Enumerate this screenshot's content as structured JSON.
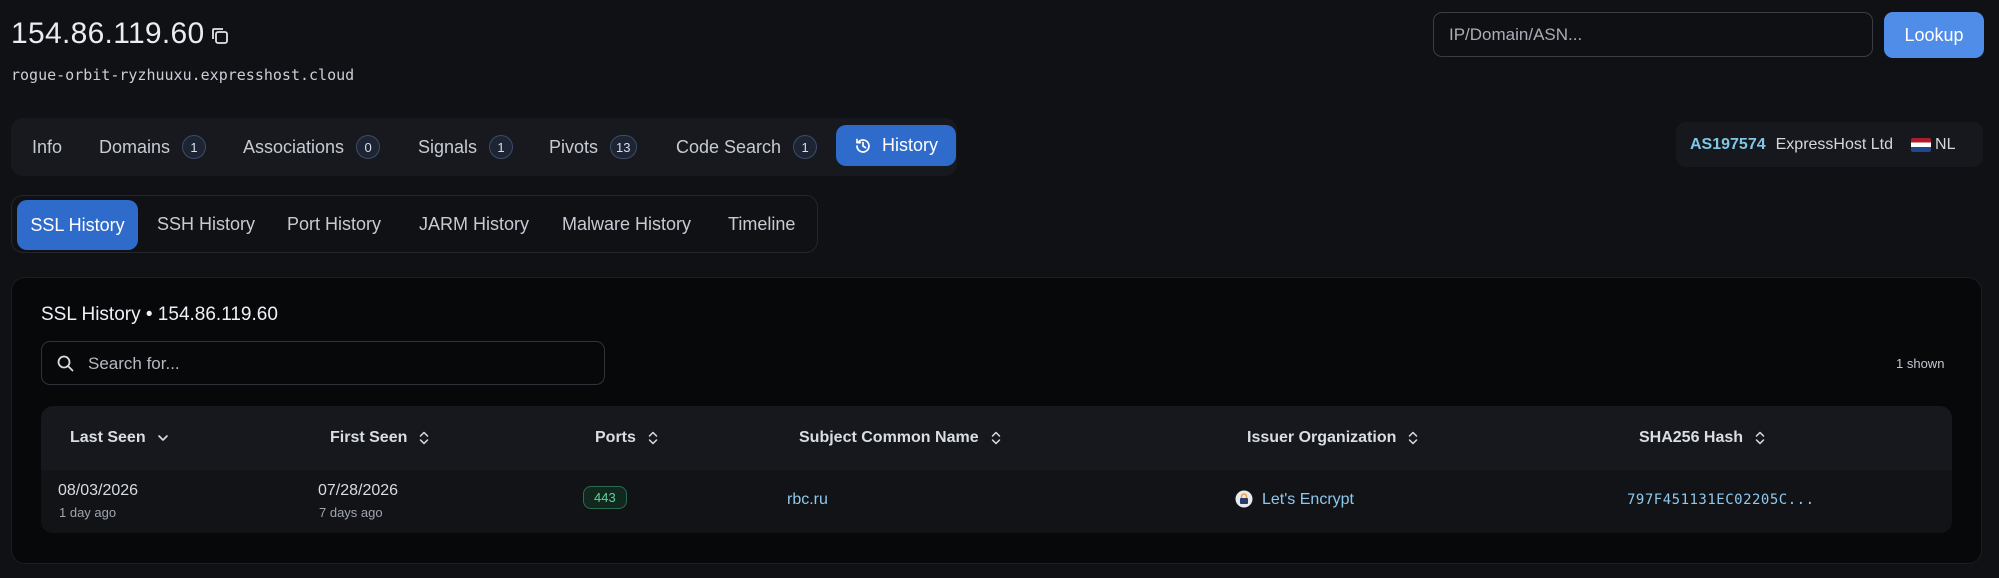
{
  "header": {
    "ip": "154.86.119.60",
    "hostname": "rogue-orbit-ryzhuuxu.expresshost.cloud"
  },
  "search": {
    "placeholder": "IP/Domain/ASN...",
    "button_label": "Lookup"
  },
  "tabs": [
    {
      "label": "Info",
      "count": null
    },
    {
      "label": "Domains",
      "count": "1"
    },
    {
      "label": "Associations",
      "count": "0"
    },
    {
      "label": "Signals",
      "count": "1"
    },
    {
      "label": "Pivots",
      "count": "13"
    },
    {
      "label": "Code Search",
      "count": "1"
    },
    {
      "label": "History",
      "count": null,
      "active": true
    }
  ],
  "asn": {
    "number": "AS197574",
    "org": "ExpressHost Ltd",
    "country": "NL"
  },
  "subtabs": [
    {
      "label": "SSL History",
      "active": true
    },
    {
      "label": "SSH History"
    },
    {
      "label": "Port History"
    },
    {
      "label": "JARM History"
    },
    {
      "label": "Malware History"
    },
    {
      "label": "Timeline"
    }
  ],
  "panel": {
    "title": "SSL History • 154.86.119.60",
    "search_placeholder": "Search for...",
    "shown_count": "1 shown"
  },
  "table": {
    "columns": [
      "Last Seen",
      "First Seen",
      "Ports",
      "Subject Common Name",
      "Issuer Organization",
      "SHA256 Hash"
    ],
    "rows": [
      {
        "last_seen": "08/03/2026",
        "last_seen_rel": "1 day ago",
        "first_seen": "07/28/2026",
        "first_seen_rel": "7 days ago",
        "port": "443",
        "subject_cn": "rbc.ru",
        "issuer": "Let's Encrypt",
        "sha256": "797F451131EC02205C..."
      }
    ]
  },
  "colors": {
    "background": "#101115",
    "accent": "#2f6bcb",
    "lookup_button": "#4f8de9",
    "link": "#8ec9ee",
    "port_badge": "#5fd39a"
  },
  "icons": [
    "copy-icon",
    "history-icon",
    "search-icon",
    "chevron-down-icon",
    "sort-icon",
    "netherlands-flag-icon",
    "letsencrypt-logo-icon"
  ]
}
